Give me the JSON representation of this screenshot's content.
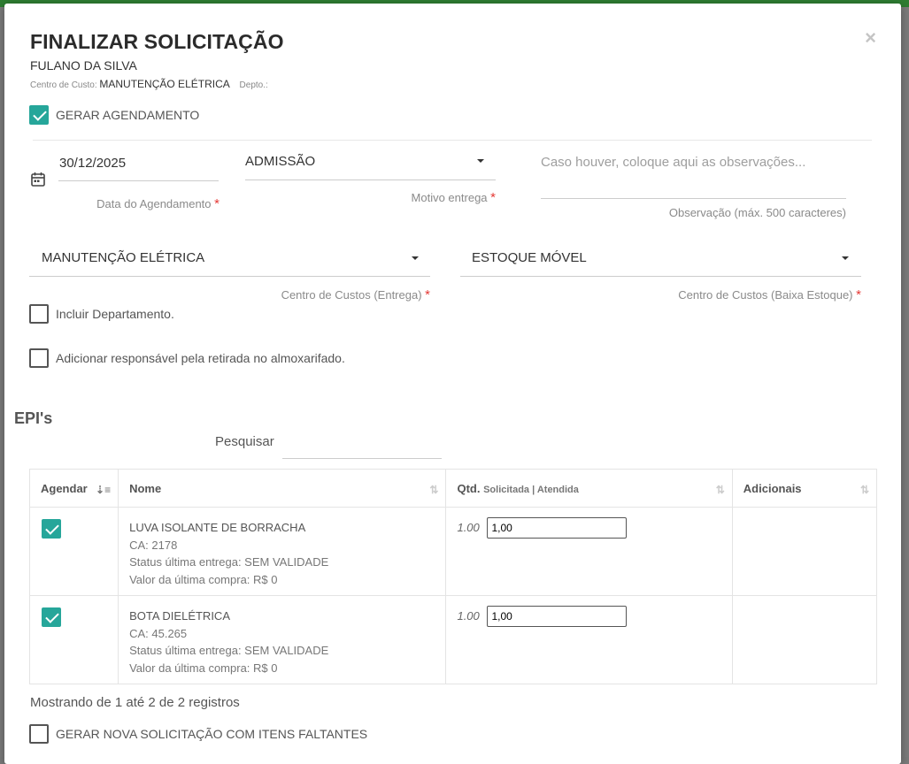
{
  "modal": {
    "title": "FINALIZAR SOLICITAÇÃO",
    "close_icon": "×",
    "employee_name": "FULANO DA SILVA",
    "cost_center_label": "Centro de Custo:",
    "cost_center_value": "MANUTENÇÃO ELÉTRICA",
    "department_label": "Depto.:"
  },
  "gerar_agendamento": {
    "label": "GERAR AGENDAMENTO",
    "checked": true
  },
  "schedule": {
    "date_value": "30/12/2025",
    "date_label": "Data do Agendamento",
    "reason_value": "ADMISSÃO",
    "reason_label": "Motivo entrega",
    "observation_placeholder": "Caso houver, coloque aqui as observações...",
    "observation_label": "Observação (máx. 500 caracteres)"
  },
  "cost_centers": {
    "delivery_value": "MANUTENÇÃO ELÉTRICA",
    "delivery_label": "Centro de Custos (Entrega)",
    "stock_value": "ESTOQUE MÓVEL",
    "stock_label": "Centro de Custos (Baixa Estoque)"
  },
  "options": {
    "include_department": "Incluir Departamento.",
    "add_responsible": "Adicionar responsável pela retirada no almoxarifado."
  },
  "epis": {
    "section_title": "EPI's",
    "search_label": "Pesquisar",
    "columns": {
      "agendar": "Agendar",
      "nome": "Nome",
      "qtd": "Qtd.",
      "qtd_sub": "Solicitada | Atendida",
      "adicionais": "Adicionais"
    },
    "rows": [
      {
        "name": "LUVA ISOLANTE DE BORRACHA",
        "ca": "CA: 2178",
        "status": "Status última entrega: SEM VALIDADE",
        "price": "Valor da última compra: R$ 0",
        "qty_requested": "1.00",
        "qty_attended": "1,00"
      },
      {
        "name": "BOTA DIELÉTRICA",
        "ca": "CA: 45.265",
        "status": "Status última entrega: SEM VALIDADE",
        "price": "Valor da última compra: R$ 0",
        "qty_requested": "1.00",
        "qty_attended": "1,00"
      }
    ],
    "records_info": "Mostrando de 1 até 2 de 2 registros"
  },
  "gerar_nova": {
    "label": "GERAR NOVA SOLICITAÇÃO COM ITENS FALTANTES"
  },
  "colors": {
    "accent": "#26a69a",
    "required": "#e53935",
    "topbar": "#2e7d32"
  }
}
